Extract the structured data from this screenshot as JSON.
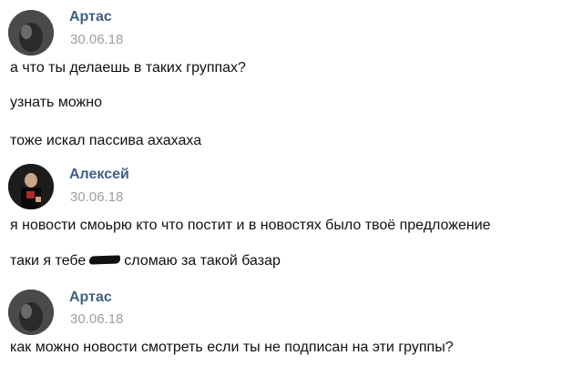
{
  "messages": [
    {
      "author": "Артас",
      "date": "30.06.18",
      "lines": [
        "а что ты делаешь в таких группах?",
        "узнать можно",
        "тоже искал пассива ахахаха"
      ]
    },
    {
      "author": "Алексей",
      "date": "30.06.18",
      "lines": [
        "я новости смоьрю кто что постит и в новостях было твоё предложение"
      ],
      "redacted_line": {
        "before": "таки я тебе",
        "after": "сломаю за такой базар"
      }
    },
    {
      "author": "Артас",
      "date": "30.06.18",
      "lines": [
        "как можно новости смотреть если ты не подписан на эти группы?"
      ]
    }
  ],
  "colors": {
    "author": "#3f5f86",
    "date": "#9aa0a6",
    "text": "#111111"
  }
}
